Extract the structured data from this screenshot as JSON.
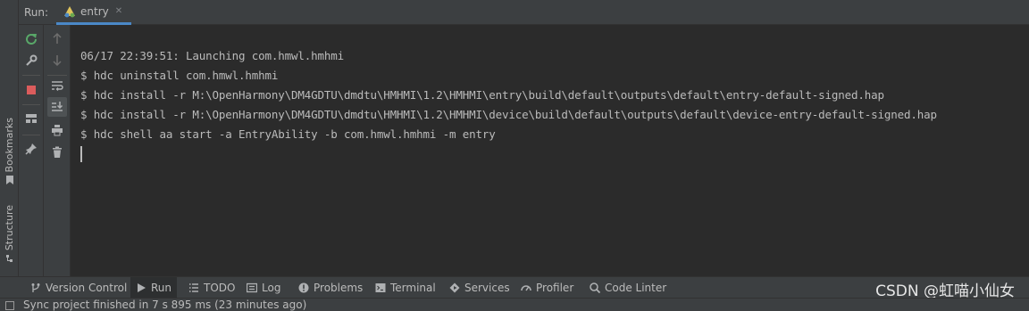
{
  "run_panel": {
    "label": "Run:",
    "tab": {
      "title": "entry",
      "icon": "harmony-triangle-icon"
    }
  },
  "side_tabs": {
    "bookmarks": "Bookmarks",
    "structure": "Structure"
  },
  "toolbar": {
    "col1": [
      "rerun-icon",
      "wrench-icon",
      "stop-icon",
      "layout-icon",
      "pin-icon"
    ],
    "col2": [
      "up-arrow-icon",
      "down-arrow-icon",
      "soft-wrap-icon",
      "scroll-to-end-icon",
      "print-icon",
      "trash-icon"
    ]
  },
  "console": {
    "lines": [
      "06/17 22:39:51: Launching com.hmwl.hmhmi",
      "$ hdc uninstall com.hmwl.hmhmi",
      "$ hdc install -r M:\\OpenHarmony\\DM4GDTU\\dmdtu\\HMHMI\\1.2\\HMHMI\\entry\\build\\default\\outputs\\default\\entry-default-signed.hap",
      "$ hdc install -r M:\\OpenHarmony\\DM4GDTU\\dmdtu\\HMHMI\\1.2\\HMHMI\\device\\build\\default\\outputs\\default\\device-entry-default-signed.hap",
      "$ hdc shell aa start -a EntryAbility -b com.hmwl.hmhmi -m entry"
    ]
  },
  "bottom_tabs": [
    {
      "label": "Version Control",
      "icon": "branch-icon"
    },
    {
      "label": "Run",
      "icon": "play-icon",
      "active": true
    },
    {
      "label": "TODO",
      "icon": "list-icon"
    },
    {
      "label": "Log",
      "icon": "log-icon"
    },
    {
      "label": "Problems",
      "icon": "warning-circle-icon"
    },
    {
      "label": "Terminal",
      "icon": "terminal-icon"
    },
    {
      "label": "Services",
      "icon": "services-icon"
    },
    {
      "label": "Profiler",
      "icon": "gauge-icon"
    },
    {
      "label": "Code Linter",
      "icon": "linter-icon"
    }
  ],
  "watermark": "CSDN @虹喵小仙女",
  "status_bar": {
    "message": "Sync project finished in 7 s 895 ms (23 minutes ago)"
  },
  "colors": {
    "accent": "#4a88c7",
    "background": "#2b2b2b",
    "panel": "#3c3f41",
    "text": "#bbbbbb",
    "rerun_green": "#59a869",
    "stop_red": "#db5c5c"
  }
}
